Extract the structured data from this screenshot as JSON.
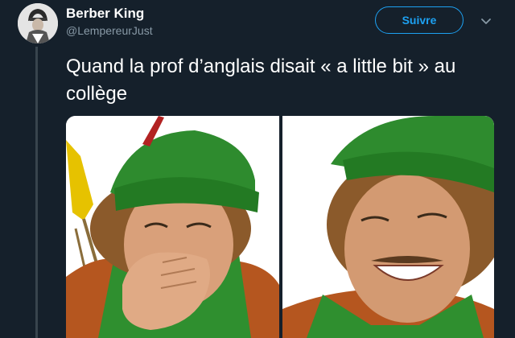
{
  "tweet": {
    "author": {
      "display_name": "Berber King",
      "handle": "@LempereurJust"
    },
    "follow_label": "Suivre",
    "menu_icon": "chevron-down-icon",
    "text": "Quand la prof d’anglais disait « a little bit » au collège"
  },
  "media": {
    "images": [
      {
        "name": "left-photo",
        "description_icon": "photo-icon"
      },
      {
        "name": "right-photo",
        "description_icon": "photo-icon"
      }
    ]
  },
  "colors": {
    "background": "#15202b",
    "accent": "#1da1f2",
    "secondary_text": "#8899a6",
    "divider": "#38444d",
    "hat_green": "#2e8b2e",
    "feather_red": "#b22222",
    "arrow_yellow": "#e6c200"
  }
}
